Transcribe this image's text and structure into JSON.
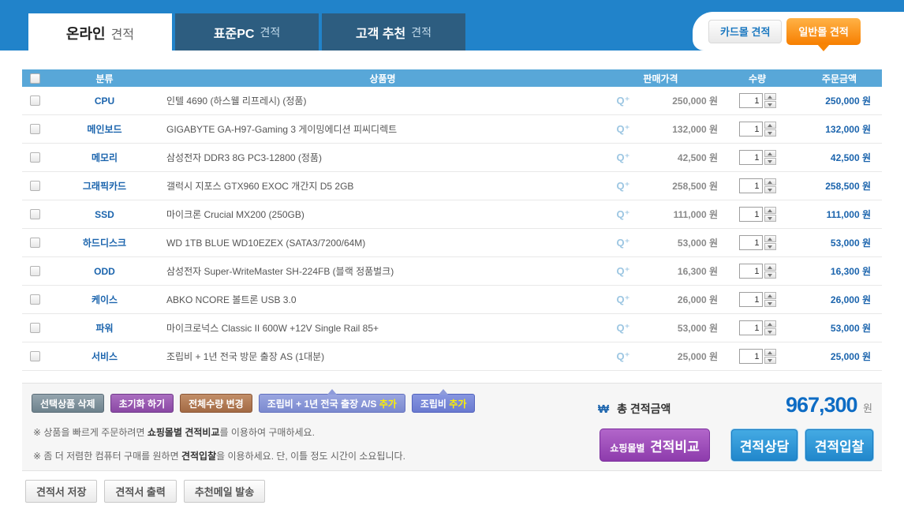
{
  "header": {
    "tabs": [
      {
        "strong": "온라인",
        "rest": "견적"
      },
      {
        "strong": "표준PC",
        "rest": "견적"
      },
      {
        "strong": "고객 추천",
        "rest": "견적"
      }
    ],
    "mall_buttons": {
      "card": "카드몰 견적",
      "general": "일반몰 견적"
    }
  },
  "table": {
    "headers": {
      "category": "분류",
      "product": "상품명",
      "price": "판매가격",
      "qty": "수량",
      "amount": "주문금액"
    },
    "zoom_icon": "Q⁺",
    "rows": [
      {
        "category": "CPU",
        "product": "인텔 4690 (하스웰 리프레시) (정품)",
        "price": "250,000 원",
        "qty": "1",
        "amount": "250,000 원"
      },
      {
        "category": "메인보드",
        "product": "GIGABYTE GA-H97-Gaming 3 게이밍에디션 피씨디렉트",
        "price": "132,000 원",
        "qty": "1",
        "amount": "132,000 원"
      },
      {
        "category": "메모리",
        "product": "삼성전자 DDR3 8G PC3-12800 (정품)",
        "price": "42,500 원",
        "qty": "1",
        "amount": "42,500 원"
      },
      {
        "category": "그래픽카드",
        "product": "갤럭시 지포스 GTX960 EXOC 개간지 D5 2GB",
        "price": "258,500 원",
        "qty": "1",
        "amount": "258,500 원"
      },
      {
        "category": "SSD",
        "product": "마이크론 Crucial MX200 (250GB)",
        "price": "111,000 원",
        "qty": "1",
        "amount": "111,000 원"
      },
      {
        "category": "하드디스크",
        "product": "WD 1TB BLUE WD10EZEX (SATA3/7200/64M)",
        "price": "53,000 원",
        "qty": "1",
        "amount": "53,000 원"
      },
      {
        "category": "ODD",
        "product": "삼성전자 Super-WriteMaster SH-224FB (블랙 정품벌크)",
        "price": "16,300 원",
        "qty": "1",
        "amount": "16,300 원"
      },
      {
        "category": "케이스",
        "product": "ABKO NCORE 볼트론 USB 3.0",
        "price": "26,000 원",
        "qty": "1",
        "amount": "26,000 원"
      },
      {
        "category": "파워",
        "product": "마이크로넉스 Classic II 600W +12V Single Rail 85+",
        "price": "53,000 원",
        "qty": "1",
        "amount": "53,000 원"
      },
      {
        "category": "서비스",
        "product": "조립비 + 1년 전국 방문 출장 AS (1대분)",
        "price": "25,000 원",
        "qty": "1",
        "amount": "25,000 원"
      }
    ]
  },
  "actions": {
    "delete_selected": "선택상품 삭제",
    "reset": "초기화 하기",
    "change_all_qty": "전체수량 변경",
    "as_label": "조립비 + 1년 전국 출장 A/S",
    "as_accent": "추가",
    "assembly_label": "조립비",
    "assembly_accent": "추가"
  },
  "notes": [
    {
      "pre": "※ 상품을 빠르게 주문하려면 ",
      "bold": "쇼핑몰별 견적비교",
      "post": "를 이용하여 구매하세요."
    },
    {
      "pre": "※ 좀 더 저렴한 컴퓨터 구매를 원하면 ",
      "bold": "견적입찰",
      "post": "을 이용하세요. 단, 이틀 정도 시간이 소요됩니다."
    }
  ],
  "total": {
    "currency_icon": "₩",
    "label": "총 견적금액",
    "amount": "967,300",
    "unit": "원",
    "compare_small": "쇼핑몰별",
    "compare_big": "견적비교",
    "consult": "견적상담",
    "bid": "견적입찰"
  },
  "footer": {
    "save": "견적서 저장",
    "print": "견적서 출력",
    "mail": "추천메일 발송"
  },
  "colors": {
    "band_blue": "#2183ca",
    "table_header_blue": "#58a7d8",
    "accent_blue": "#1b64ad",
    "orange": "#f77f00"
  }
}
